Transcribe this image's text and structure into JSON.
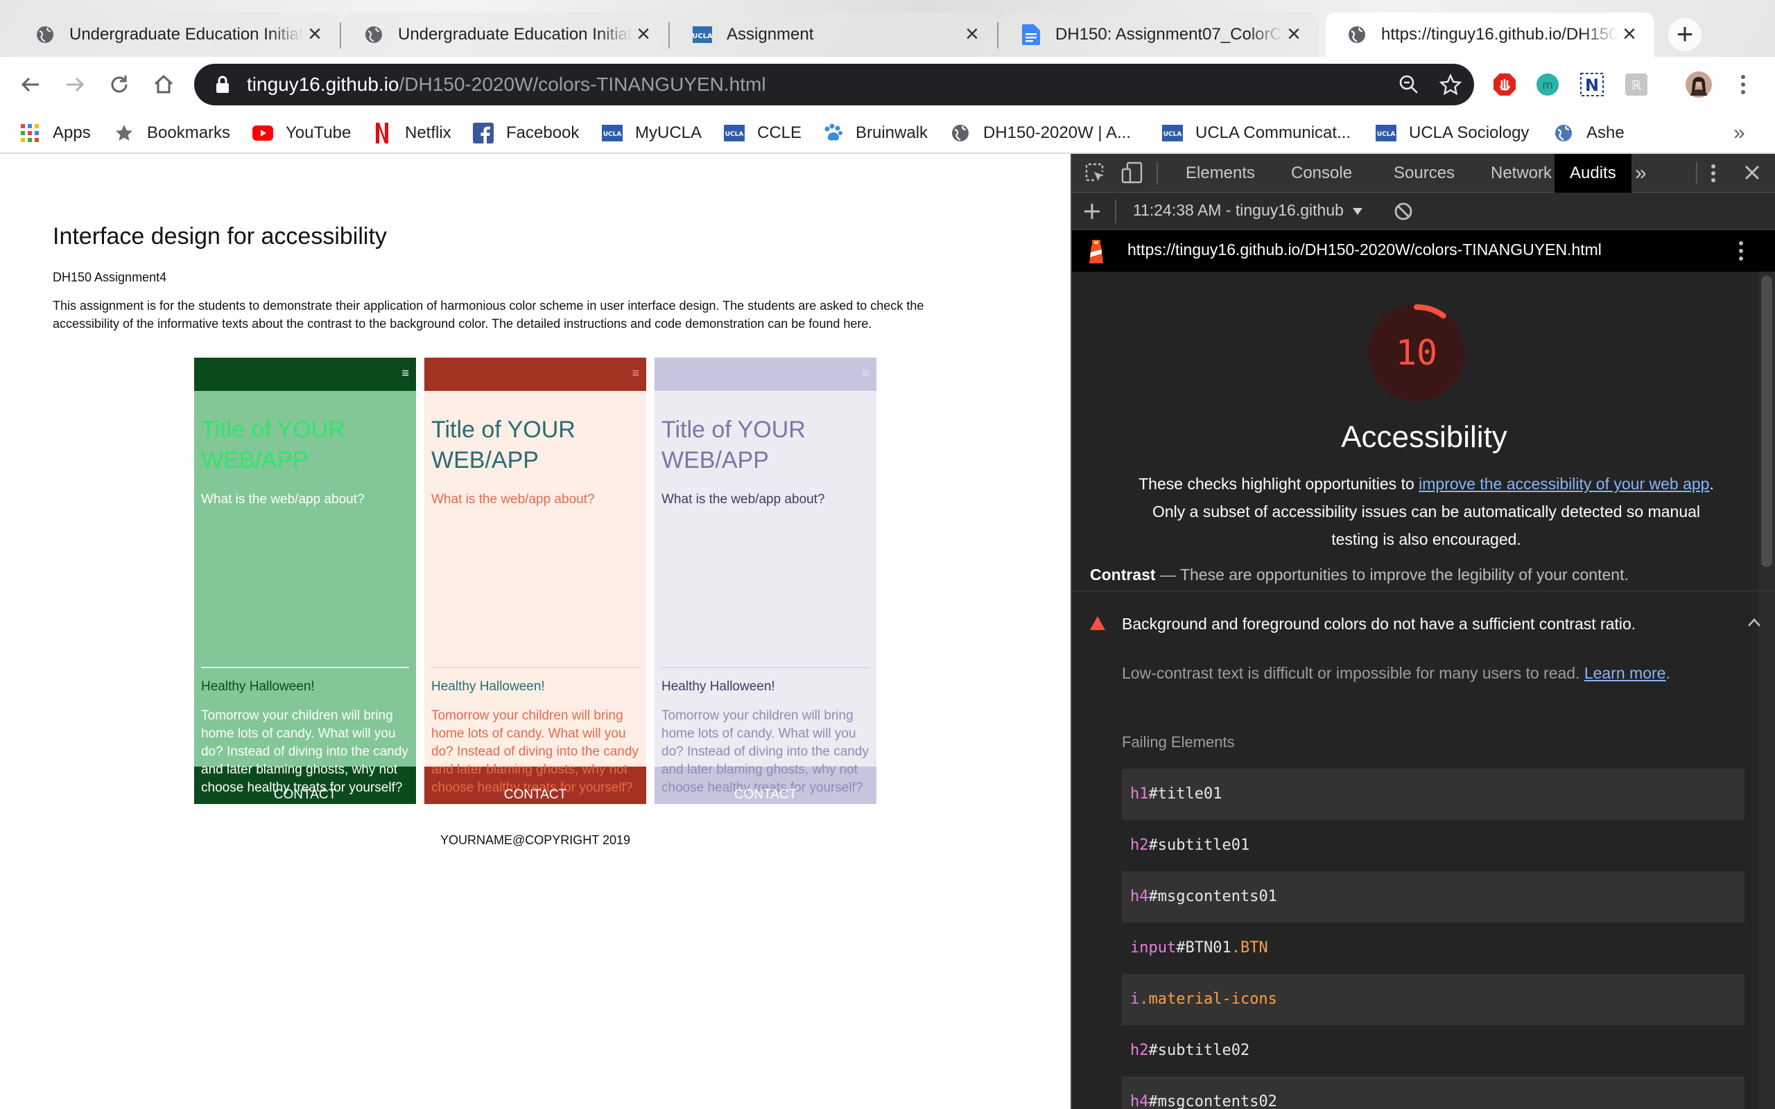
{
  "browser": {
    "tabs": [
      {
        "title": "Undergraduate Education Initiatives",
        "favicon": "globe-icon",
        "active": false
      },
      {
        "title": "Undergraduate Education Initiatives",
        "favicon": "globe-icon",
        "active": false
      },
      {
        "title": "Assignment",
        "favicon": "ucla-icon",
        "active": false
      },
      {
        "title": "DH150: Assignment07_ColorContrast",
        "favicon": "google-docs-icon",
        "active": false
      },
      {
        "title": "https://tinguy16.github.io/DH150-2020W/colors-TINANGUYEN.html",
        "favicon": "globe-icon",
        "active": true
      }
    ],
    "new_tab_symbol": "+",
    "address": {
      "host": "tinguy16.github.io",
      "path": "/DH150-2020W/colors-TINANGUYEN.html"
    },
    "bookmarks": [
      {
        "label": "Apps",
        "icon": "apps-grid-icon"
      },
      {
        "label": "Bookmarks",
        "icon": "star-icon"
      },
      {
        "label": "YouTube",
        "icon": "youtube-icon"
      },
      {
        "label": "Netflix",
        "icon": "netflix-icon"
      },
      {
        "label": "Facebook",
        "icon": "facebook-icon"
      },
      {
        "label": "MyUCLA",
        "icon": "ucla-icon"
      },
      {
        "label": "CCLE",
        "icon": "ucla-icon"
      },
      {
        "label": "Bruinwalk",
        "icon": "paw-icon"
      },
      {
        "label": "DH150-2020W | A...",
        "icon": "globe-icon"
      },
      {
        "label": "UCLA Communicat...",
        "icon": "ucla-icon"
      },
      {
        "label": "UCLA Sociology",
        "icon": "ucla-icon"
      },
      {
        "label": "Ashe",
        "icon": "globe-icon"
      }
    ],
    "overflow_symbol": "»"
  },
  "page": {
    "title": "Interface design for accessibility",
    "subtitle": "DH150 Assignment4",
    "description": "This assignment is for the students to demonstrate their application of harmonious color scheme in user interface design. The students are asked to check the accessibility of the informative texts about the contrast to the background color. The detailed instructions and code demonstration can be found here.",
    "mockups": [
      {
        "title": "Title of YOUR WEB/APP",
        "about": "What is the web/app about?",
        "msg_title": "Healthy Halloween!",
        "msg_body": "Tomorrow your children will bring home lots of candy. What will you do? Instead of diving into the candy and later blaming ghosts, why not choose healthy treats for yourself?",
        "button": "CONTACT",
        "menu_symbol": "≡",
        "colors": {
          "bar": "#0b4a1c",
          "bg": "#83c697",
          "title": "#2ee66a",
          "about": "#ffffff",
          "hr": "#e8f5ea",
          "msg_title": "#0b4a1c",
          "body": "#ffffff",
          "footer": "#0b4a1c",
          "contact": "#ffffff",
          "menu": "#ffffff"
        }
      },
      {
        "title": "Title of YOUR WEB/APP",
        "about": "What is the web/app about?",
        "msg_title": "Healthy Halloween!",
        "msg_body": "Tomorrow your children will bring home lots of candy. What will you do? Instead of diving into the candy and later blaming ghosts, why not choose healthy treats for yourself?",
        "button": "CONTACT",
        "menu_symbol": "≡",
        "colors": {
          "bar": "#a33222",
          "bg": "#fdeee6",
          "title": "#2a6b72",
          "about": "#e7694b",
          "hr": "#fbd8c9",
          "msg_title": "#2a6b72",
          "body": "#e7694b",
          "footer": "#a33222",
          "contact": "#ffffff",
          "menu": "#f2a28f"
        }
      },
      {
        "title": "Title of YOUR WEB/APP",
        "about": "What is the web/app about?",
        "msg_title": "Healthy Halloween!",
        "msg_body": "Tomorrow your children will bring home lots of candy. What will you do? Instead of diving into the candy and later blaming ghosts, why not choose healthy treats for yourself?",
        "button": "CONTACT",
        "menu_symbol": "≡",
        "colors": {
          "bar": "#c5c6de",
          "bg": "#ebebf1",
          "title": "#7b75a8",
          "about": "#3f3a64",
          "hr": "#d9d9e6",
          "msg_title": "#3f3a64",
          "body": "#8f8ab8",
          "footer": "#c5c6de",
          "contact": "#ffffff",
          "menu": "#e6e6f2"
        }
      }
    ],
    "copyright": "YOURNAME@COPYRIGHT 2019"
  },
  "devtools": {
    "tabs": [
      {
        "label": "Elements",
        "active": false
      },
      {
        "label": "Console",
        "active": false
      },
      {
        "label": "Sources",
        "active": false
      },
      {
        "label": "Network",
        "active": false
      },
      {
        "label": "Audits",
        "active": true
      }
    ],
    "more_tabs_symbol": "»",
    "run_label": "11:24:38 AM - tinguy16.github",
    "report_url": "https://tinguy16.github.io/DH150-2020W/colors-TINANGUYEN.html",
    "score": 10,
    "score_color": "#ff4e42",
    "category_title": "Accessibility",
    "desc_before": "These checks highlight opportunities to ",
    "desc_link": "improve the accessibility of your web app",
    "desc_after": ". Only a subset of accessibility issues can be automatically detected so manual testing is also encouraged.",
    "group_title": "Contrast",
    "group_separator": "—",
    "group_desc": "These are opportunities to improve the legibility of your content.",
    "audit_title": "Background and foreground colors do not have a sufficient contrast ratio.",
    "audit_desc": "Low-contrast text is difficult or impossible for many users to read.",
    "audit_link": "Learn more",
    "audit_period": ".",
    "failing_label": "Failing Elements",
    "failing_elements": [
      {
        "tag": "h1",
        "rest": "#title01",
        "cls": ""
      },
      {
        "tag": "h2",
        "rest": "#subtitle01",
        "cls": ""
      },
      {
        "tag": "h4",
        "rest": "#msgcontents01",
        "cls": ""
      },
      {
        "tag": "input",
        "rest": "#BTN01",
        "cls": ".BTN"
      },
      {
        "tag": "i",
        "rest": "",
        "cls": ".material-icons"
      },
      {
        "tag": "h2",
        "rest": "#subtitle02",
        "cls": ""
      },
      {
        "tag": "h4",
        "rest": "#msgcontents02",
        "cls": ""
      }
    ]
  }
}
